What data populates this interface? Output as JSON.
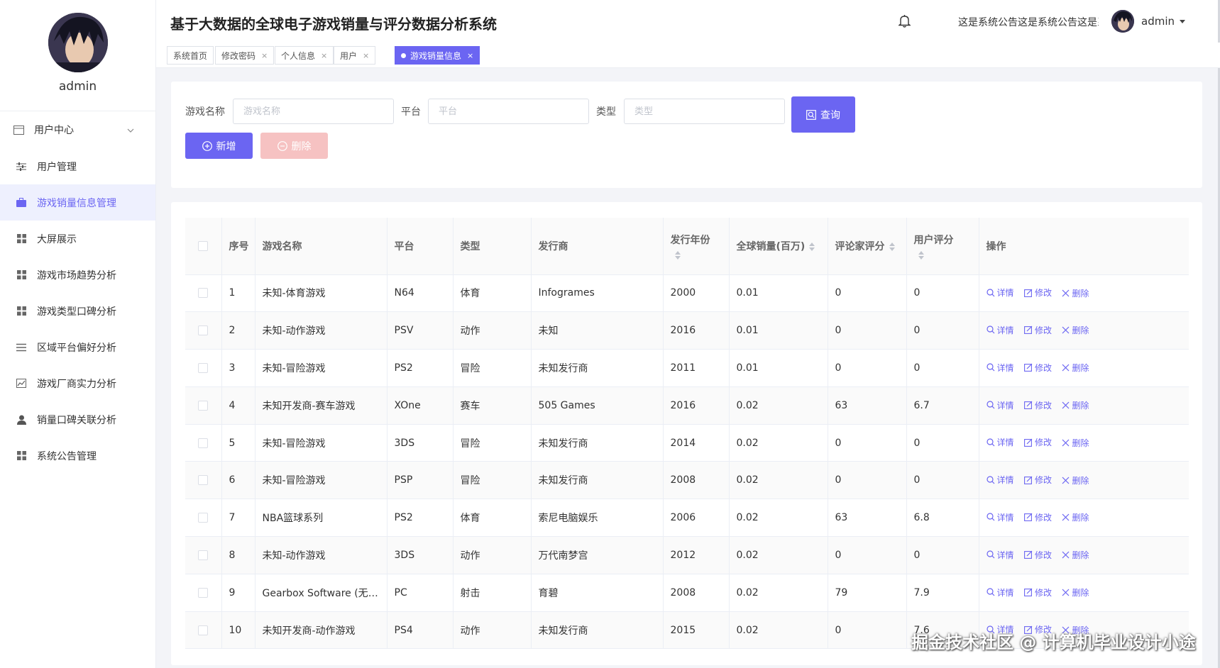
{
  "user": {
    "name": "admin"
  },
  "sidebar": {
    "group_label": "用户中心",
    "items": [
      {
        "label": "用户管理",
        "icon": "sliders-icon"
      },
      {
        "label": "游戏销量信息管理",
        "icon": "briefcase-icon"
      },
      {
        "label": "大屏展示",
        "icon": "grid-icon"
      },
      {
        "label": "游戏市场趋势分析",
        "icon": "grid-icon"
      },
      {
        "label": "游戏类型口碑分析",
        "icon": "grid-icon"
      },
      {
        "label": "区域平台偏好分析",
        "icon": "list-icon"
      },
      {
        "label": "游戏厂商实力分析",
        "icon": "chart-icon"
      },
      {
        "label": "销量口碑关联分析",
        "icon": "person-icon"
      },
      {
        "label": "系统公告管理",
        "icon": "grid-icon"
      }
    ]
  },
  "header": {
    "title": "基于大数据的全球电子游戏销量与评分数据分析系统",
    "notice": "这是系统公告这是系统公告这是系统公告",
    "username": "admin"
  },
  "tabs": [
    {
      "label": "系统首页",
      "closable": false
    },
    {
      "label": "修改密码",
      "closable": true
    },
    {
      "label": "个人信息",
      "closable": true
    },
    {
      "label": "用户",
      "closable": true
    },
    {
      "label": "游戏销量信息",
      "closable": true
    }
  ],
  "search": {
    "name_label": "游戏名称",
    "name_placeholder": "游戏名称",
    "platform_label": "平台",
    "platform_placeholder": "平台",
    "type_label": "类型",
    "type_placeholder": "类型",
    "query_label": "查询",
    "add_label": "新增",
    "delete_label": "删除"
  },
  "table": {
    "columns": [
      "序号",
      "游戏名称",
      "平台",
      "类型",
      "发行商",
      "发行年份",
      "全球销量(百万)",
      "评论家评分",
      "用户评分",
      "操作"
    ],
    "actions": {
      "detail": "详情",
      "edit": "修改",
      "delete": "删除"
    },
    "rows": [
      [
        "1",
        "未知-体育游戏",
        "N64",
        "体育",
        "Infogrames",
        "2000",
        "0.01",
        "0",
        "0"
      ],
      [
        "2",
        "未知-动作游戏",
        "PSV",
        "动作",
        "未知",
        "2016",
        "0.01",
        "0",
        "0"
      ],
      [
        "3",
        "未知-冒险游戏",
        "PS2",
        "冒险",
        "未知发行商",
        "2011",
        "0.01",
        "0",
        "0"
      ],
      [
        "4",
        "未知开发商-赛车游戏",
        "XOne",
        "赛车",
        "505 Games",
        "2016",
        "0.02",
        "63",
        "6.7"
      ],
      [
        "5",
        "未知-冒险游戏",
        "3DS",
        "冒险",
        "未知发行商",
        "2014",
        "0.02",
        "0",
        "0"
      ],
      [
        "6",
        "未知-冒险游戏",
        "PSP",
        "冒险",
        "未知发行商",
        "2008",
        "0.02",
        "0",
        "0"
      ],
      [
        "7",
        "NBA篮球系列",
        "PS2",
        "体育",
        "索尼电脑娱乐",
        "2006",
        "0.02",
        "63",
        "6.8"
      ],
      [
        "8",
        "未知-动作游戏",
        "3DS",
        "动作",
        "万代南梦宫",
        "2012",
        "0.02",
        "0",
        "0"
      ],
      [
        "9",
        "Gearbox Software (无主...",
        "PC",
        "射击",
        "育碧",
        "2008",
        "0.02",
        "79",
        "7.9"
      ],
      [
        "10",
        "未知开发商-动作游戏",
        "PS4",
        "动作",
        "未知发行商",
        "2015",
        "0.02",
        "0",
        "7.6"
      ]
    ]
  },
  "watermark": "掘金技术社区 @ 计算机毕业设计小途",
  "colors": {
    "accent": "#6b65f2",
    "danger_light": "#f6c2c2",
    "bg": "#f3f4f8"
  }
}
